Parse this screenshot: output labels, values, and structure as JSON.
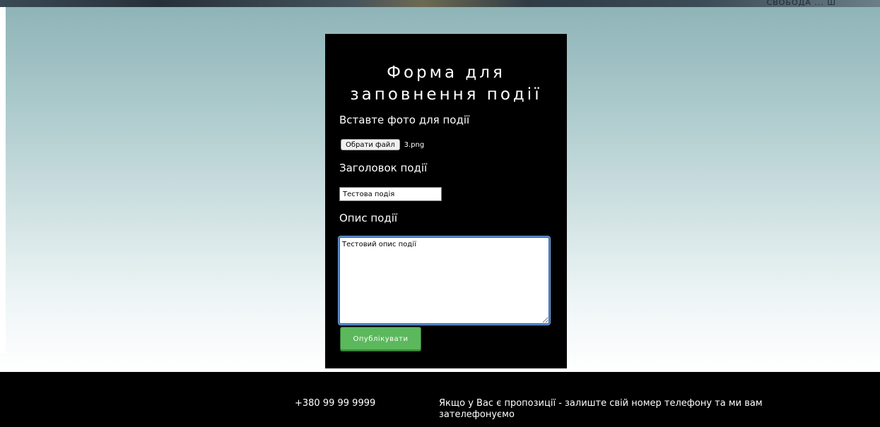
{
  "header": {
    "strip_text": "СВОБОДА ... Ш"
  },
  "form": {
    "title": "Форма для заповнення події",
    "photo_label": "Вставте фото для події",
    "file_button_label": "Обрати файл",
    "file_name": "3.png",
    "title_label": "Заголовок події",
    "title_value": "Тестова подія",
    "description_label": "Опис події",
    "description_value": "Тестовий опис події",
    "publish_label": "Опублікувати"
  },
  "footer": {
    "phone": "+380 99 99 9999",
    "note": "Якщо у Вас є пропозиції - залиште свій номер телефону та ми вам зателефонуємо"
  },
  "colors": {
    "card_bg": "#000000",
    "publish_button": "#5cb85c",
    "footer_bg": "#000000",
    "textarea_focus": "#3b6fb4"
  }
}
